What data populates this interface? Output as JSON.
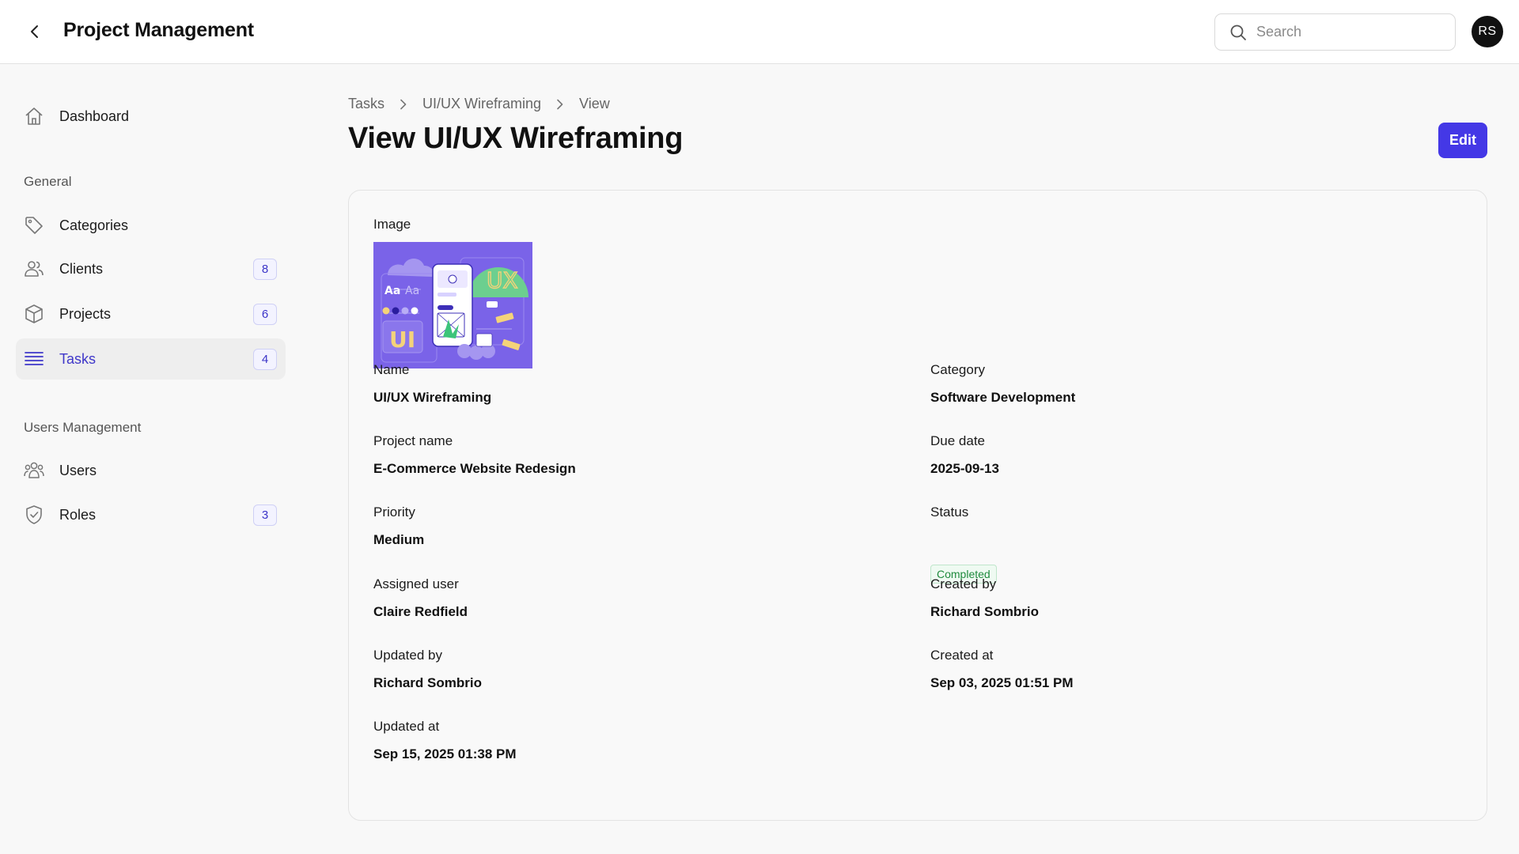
{
  "header": {
    "title": "Project Management",
    "search_placeholder": "Search",
    "avatar_initials": "RS"
  },
  "sidebar": {
    "dashboard": "Dashboard",
    "section_general": "General",
    "items_general": [
      {
        "label": "Categories",
        "icon": "tag-icon",
        "badge": null
      },
      {
        "label": "Clients",
        "icon": "users-icon",
        "badge": "8"
      },
      {
        "label": "Projects",
        "icon": "cube-icon",
        "badge": "6"
      },
      {
        "label": "Tasks",
        "icon": "list-icon",
        "badge": "4",
        "active": true
      }
    ],
    "section_users": "Users Management",
    "items_users": [
      {
        "label": "Users",
        "icon": "group-icon",
        "badge": null
      },
      {
        "label": "Roles",
        "icon": "shield-icon",
        "badge": "3"
      }
    ]
  },
  "breadcrumb": [
    "Tasks",
    "UI/UX Wireframing",
    "View"
  ],
  "page": {
    "title": "View UI/UX Wireframing",
    "edit_label": "Edit"
  },
  "details": {
    "image_label": "Image",
    "image_text": {
      "ux": "UX",
      "ui": "UI",
      "aa_bold": "Aa",
      "aa_light": "Aa"
    },
    "name_label": "Name",
    "name": "UI/UX Wireframing",
    "category_label": "Category",
    "category": "Software Development",
    "project_label": "Project name",
    "project": "E-Commerce Website Redesign",
    "due_label": "Due date",
    "due": "2025-09-13",
    "priority_label": "Priority",
    "priority": "Medium",
    "status_label": "Status",
    "status": "Completed",
    "assigned_label": "Assigned user",
    "assigned": "Claire Redfield",
    "created_by_label": "Created by",
    "created_by": "Richard Sombrio",
    "updated_by_label": "Updated by",
    "updated_by": "Richard Sombrio",
    "created_at_label": "Created at",
    "created_at": "Sep 03, 2025 01:51 PM",
    "updated_at_label": "Updated at",
    "updated_at": "Sep 15, 2025 01:38 PM"
  },
  "colors": {
    "accent": "#4438e6",
    "status_green": "#1f8a3d",
    "illustration_bg": "#7a63e8"
  }
}
